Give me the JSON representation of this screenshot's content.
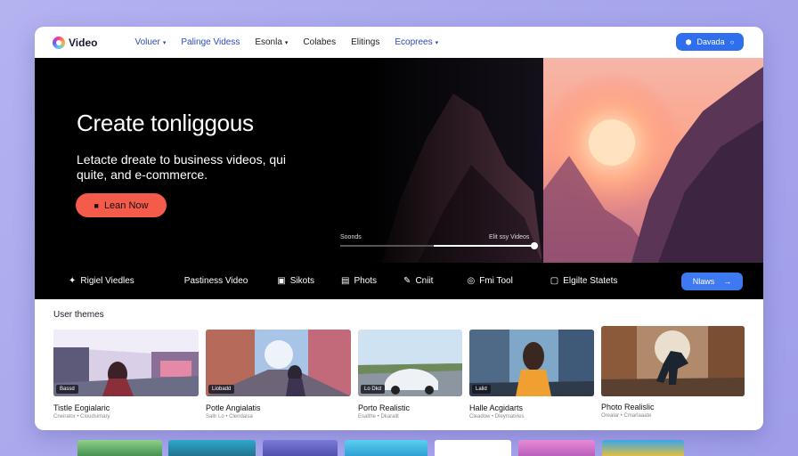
{
  "nav": {
    "logo_text": "Video",
    "links": [
      {
        "label": "Voluer",
        "caret": "▾",
        "blue": true
      },
      {
        "label": "Palinge Videss",
        "caret": "",
        "blue": true
      },
      {
        "label": "Esonla",
        "caret": "▾",
        "blue": false
      },
      {
        "label": "Colabes",
        "caret": "",
        "blue": false
      },
      {
        "label": "Elitings",
        "caret": "",
        "blue": false
      },
      {
        "label": "Ecoprees",
        "caret": "▾",
        "blue": true
      }
    ],
    "cta_label": "Davada",
    "cta_icon": "shield-icon"
  },
  "hero": {
    "title": "Create tonliggous",
    "subtitle": "Letacte dreate to business videos, qui quite, and e-commerce.",
    "cta_label": "Lean Now",
    "cta_icon": "lock-icon",
    "slider_left_label": "Soonds",
    "slider_right_label": "Elit ssy Videos",
    "slider_value": 0.52
  },
  "toolbar": {
    "items": [
      {
        "icon": "sparkle-icon",
        "glyph": "✦",
        "label": "Rigiel Viedles"
      },
      {
        "icon": "",
        "glyph": "",
        "label": "Pastiness Video"
      },
      {
        "icon": "slides-icon",
        "glyph": "▣",
        "label": "Sikots"
      },
      {
        "icon": "photo-icon",
        "glyph": "▤",
        "label": "Phots"
      },
      {
        "icon": "brush-icon",
        "glyph": "✎",
        "label": "Cniit"
      },
      {
        "icon": "tool-icon",
        "glyph": "◎",
        "label": "Fmi Tool"
      },
      {
        "icon": "stats-icon",
        "glyph": "▢",
        "label": "Elgilte Statets"
      }
    ],
    "cta_label": "Nlaws",
    "cta_arrow": "→"
  },
  "section": {
    "title": "User themes"
  },
  "cards": [
    {
      "tag": "Bassd",
      "title": "Tistle Eogialaric",
      "meta": "Cneirator • Cloudsimary"
    },
    {
      "tag": "Liobadd",
      "title": "Potle Angialatis",
      "meta": "Saltr Lo • Clendaisa"
    },
    {
      "tag": "Lo Dkd",
      "title": "Porto Realistic",
      "meta": "Esalthe • Dkaralit"
    },
    {
      "tag": "Lalid",
      "title": "Halle Acgidarts",
      "meta": "Cleadow • Dleymatvies"
    },
    {
      "tag": "",
      "title": "Photo Realislic",
      "meta": "Orealar • Cmarlaaate"
    }
  ]
}
